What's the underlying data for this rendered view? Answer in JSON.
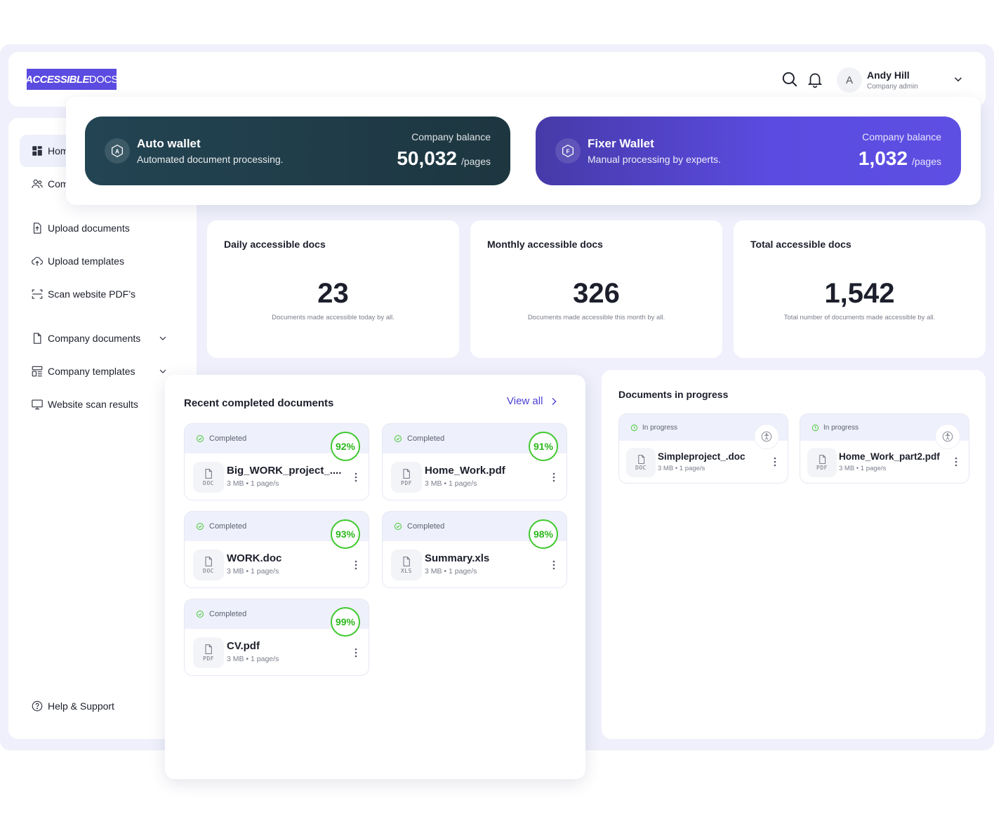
{
  "app": {
    "logo_bold": "ACCESSIBLE",
    "logo_light": "DOCS"
  },
  "user": {
    "initial": "A",
    "name": "Andy Hill",
    "role": "Company admin"
  },
  "sidebar": {
    "items": [
      {
        "label": "Hom",
        "icon": "grid-icon"
      },
      {
        "label": "Com",
        "icon": "users-icon"
      },
      {
        "label": "Upload documents",
        "icon": "file-upload-icon"
      },
      {
        "label": "Upload templates",
        "icon": "cloud-upload-icon"
      },
      {
        "label": "Scan website PDF’s",
        "icon": "scan-icon"
      },
      {
        "label": "Company documents",
        "icon": "document-icon"
      },
      {
        "label": "Company templates",
        "icon": "template-icon"
      },
      {
        "label": "Website scan results",
        "icon": "monitor-icon"
      }
    ],
    "help": "Help & Support"
  },
  "wallets": {
    "auto": {
      "badge": "A",
      "title": "Auto wallet",
      "subtitle": "Automated document processing.",
      "balance_label": "Company balance",
      "balance": "50,032",
      "unit": "/pages"
    },
    "fixer": {
      "badge": "F",
      "title": "Fixer Wallet",
      "subtitle": "Manual processing by experts.",
      "balance_label": "Company balance",
      "balance": "1,032",
      "unit": "/pages"
    }
  },
  "stats": [
    {
      "title": "Daily accessible docs",
      "value": "23",
      "desc": "Documents made accessible today by all."
    },
    {
      "title": "Monthly accessible docs",
      "value": "326",
      "desc": "Documents made accessible this month by all."
    },
    {
      "title": "Total accessible docs",
      "value": "1,542",
      "desc": "Total number of documents made accessible by all."
    }
  ],
  "recent": {
    "title": "Recent completed documents",
    "view_all": "View all",
    "docs": [
      {
        "status": "Completed",
        "pct": "92%",
        "name": "Big_WORK_project_....",
        "ext": "DOC",
        "size": "3 MB",
        "pages": "1 page/s"
      },
      {
        "status": "Completed",
        "pct": "91%",
        "name": "Home_Work.pdf",
        "ext": "PDF",
        "size": "3 MB",
        "pages": "1 page/s"
      },
      {
        "status": "Completed",
        "pct": "93%",
        "name": "WORK.doc",
        "ext": "DOC",
        "size": "3 MB",
        "pages": "1 page/s"
      },
      {
        "status": "Completed",
        "pct": "98%",
        "name": "Summary.xls",
        "ext": "XLS",
        "size": "3 MB",
        "pages": "1 page/s"
      },
      {
        "status": "Completed",
        "pct": "99%",
        "name": "CV.pdf",
        "ext": "PDF",
        "size": "3 MB",
        "pages": "1 page/s"
      }
    ]
  },
  "in_progress": {
    "title": "Documents in progress",
    "docs": [
      {
        "status": "In progress",
        "name": "Simpleproject_.doc",
        "ext": "DOC",
        "size": "3 MB",
        "pages": "1 page/s"
      },
      {
        "status": "In progress",
        "name": "Home_Work_part2.pdf",
        "ext": "PDF",
        "size": "3 MB",
        "pages": "1 page/s"
      }
    ]
  },
  "colors": {
    "brand": "#5b4be0",
    "auto_wallet": "#234453",
    "completed_green": "#41c92f",
    "frame_bg": "#eff0fb"
  }
}
